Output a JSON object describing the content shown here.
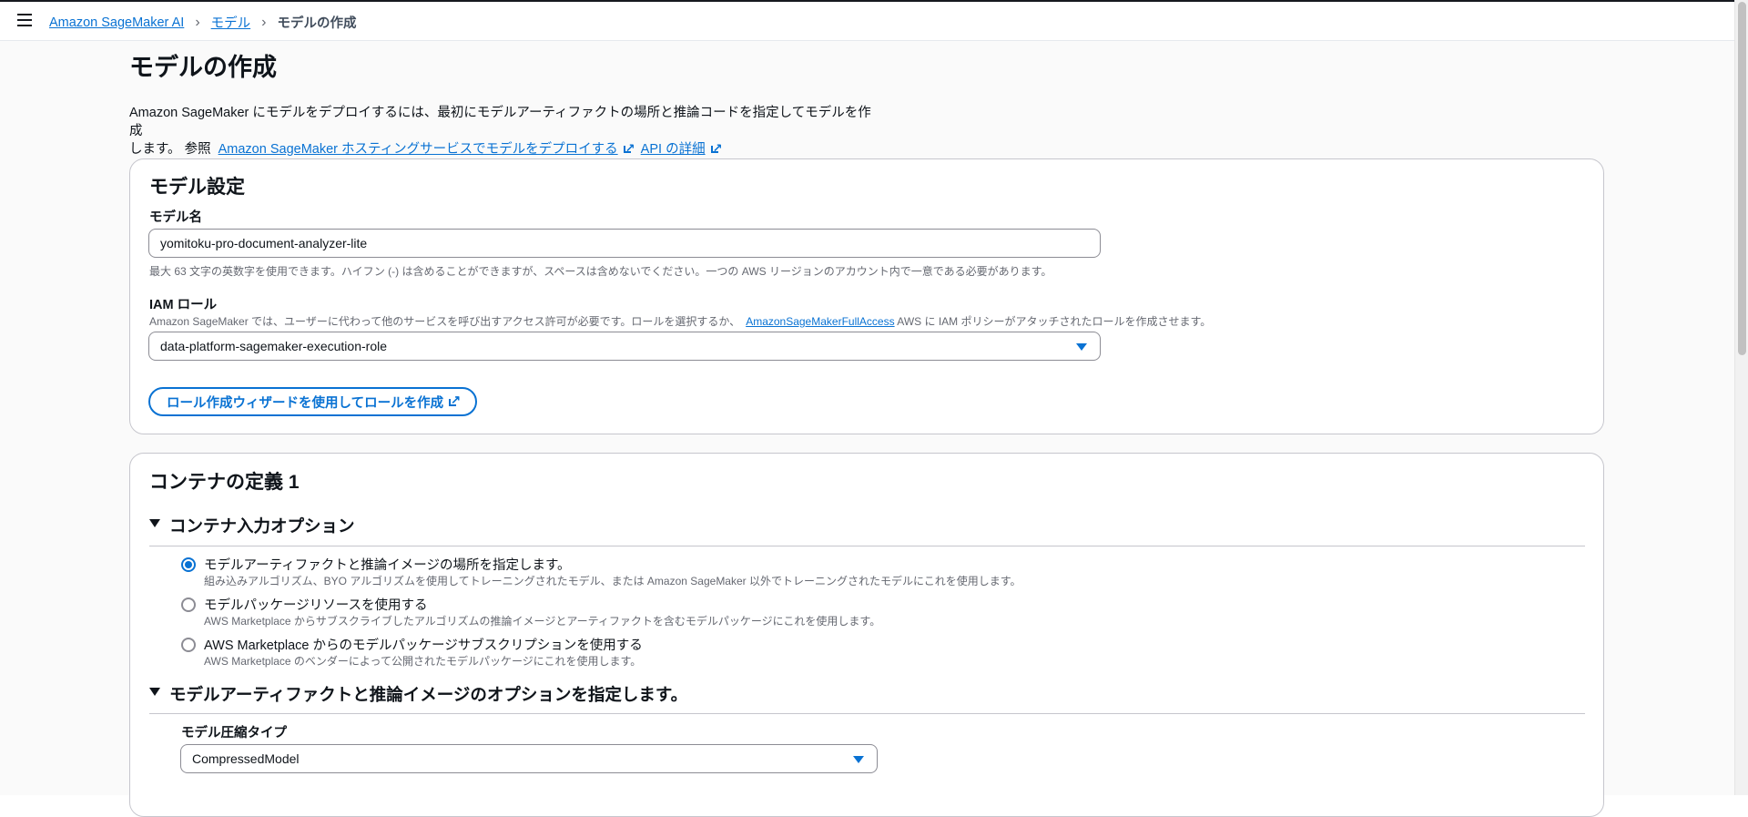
{
  "breadcrumb": {
    "root": "Amazon SageMaker AI",
    "section": "モデル",
    "current": "モデルの作成"
  },
  "page": {
    "title": "モデルの作成",
    "description_line1": "Amazon SageMaker にモデルをデプロイするには、最初にモデルアーティファクトの場所と推論コードを指定してモデルを作成",
    "description_line2": "します。 参照",
    "link_hosting": "Amazon SageMaker ホスティングサービスでモデルをデプロイする",
    "link_api": "API の詳細"
  },
  "model_settings": {
    "title": "モデル設定",
    "name_label": "モデル名",
    "name_value": "yomitoku-pro-document-analyzer-lite",
    "name_hint": "最大 63 文字の英数字を使用できます。ハイフン (-) は含めることができますが、スペースは含めないでください。一つの AWS リージョンのアカウント内で一意である必要があります。",
    "iam_label": "IAM ロール",
    "iam_hint_before": "Amazon SageMaker では、ユーザーに代わって他のサービスを呼び出すアクセス許可が必要です。ロールを選択するか、",
    "iam_hint_link": "AmazonSageMakerFullAccess",
    "iam_hint_after": "AWS に IAM ポリシーがアタッチされたロールを作成させます。",
    "iam_value": "data-platform-sagemaker-execution-role",
    "wizard_button": "ロール作成ウィザードを使用してロールを作成"
  },
  "container": {
    "title": "コンテナの定義 1",
    "input_options_title": "コンテナ入力オプション",
    "options": [
      {
        "label": "モデルアーティファクトと推論イメージの場所を指定します。",
        "desc": "組み込みアルゴリズム、BYO アルゴリズムを使用してトレーニングされたモデル、または Amazon SageMaker 以外でトレーニングされたモデルにこれを使用します。"
      },
      {
        "label": "モデルパッケージリソースを使用する",
        "desc": "AWS Marketplace からサブスクライブしたアルゴリズムの推論イメージとアーティファクトを含むモデルパッケージにこれを使用します。"
      },
      {
        "label": "AWS Marketplace からのモデルパッケージサブスクリプションを使用する",
        "desc": "AWS Marketplace のベンダーによって公開されたモデルパッケージにこれを使用します。"
      }
    ],
    "artifact_options_title": "モデルアーティファクトと推論イメージのオプションを指定します。",
    "compression_label": "モデル圧縮タイプ",
    "compression_value": "CompressedModel"
  }
}
